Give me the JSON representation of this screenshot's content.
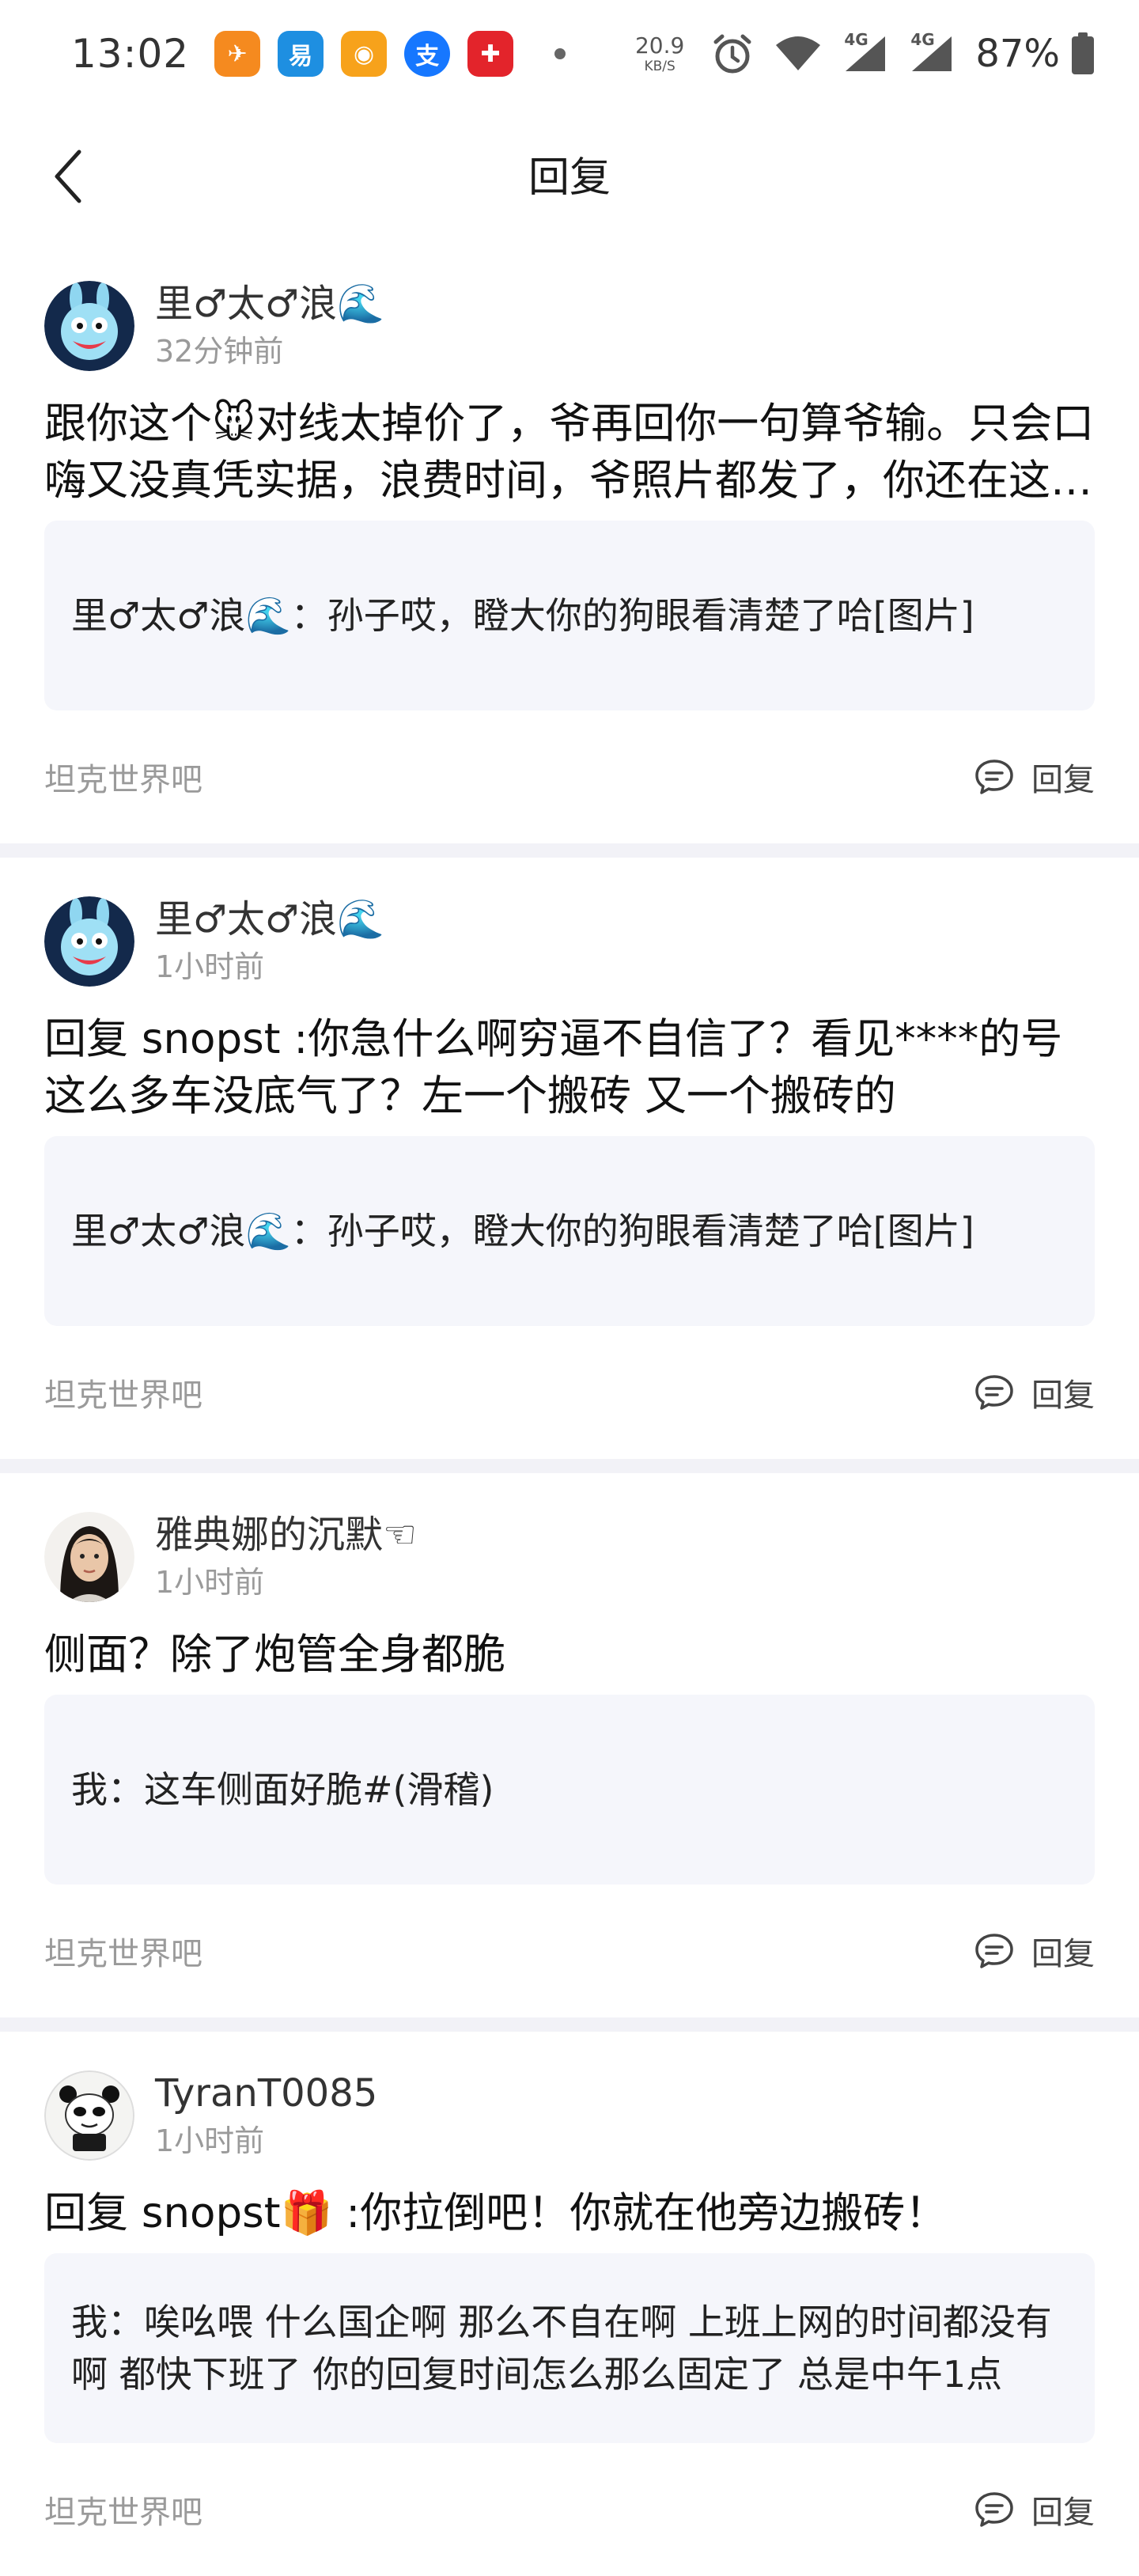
{
  "status_bar": {
    "time": "13:02",
    "net_speed_value": "20.9",
    "net_speed_unit": "KB/S",
    "battery": "87%",
    "app_icons": [
      {
        "name": "meituan-app-icon",
        "glyph": "✈",
        "color": "#f58a1f"
      },
      {
        "name": "yi-app-icon",
        "glyph": "易",
        "color": "#1e8fe1"
      },
      {
        "name": "suning-app-icon",
        "glyph": "◉",
        "color": "#f7a21b"
      },
      {
        "name": "alipay-app-icon",
        "glyph": "支",
        "color": "#1677ff"
      },
      {
        "name": "carrefour-app-icon",
        "glyph": "✚",
        "color": "#e3242b"
      }
    ],
    "network_label_1": "4G",
    "network_label_2": "4G"
  },
  "header": {
    "title": "回复"
  },
  "cards": [
    {
      "author": "里♂太♂浪🌊",
      "time": "32分钟前",
      "reply": "跟你这个🐭对线太掉价了，爷再回你一句算爷输。只会口嗨又没真凭实据，浪费时间，爷照片都发了，你还在这里嘴硬",
      "quote": "里♂太♂浪🌊：孙子哎，瞪大你的狗眼看清楚了哈[图片]",
      "forum": "坦克世界吧",
      "reply_label": "回复",
      "avatar": "cartoon-blue"
    },
    {
      "author": "里♂太♂浪🌊",
      "time": "1小时前",
      "reply": "回复 snopst  :你急什么啊穷逼不自信了？看见****的号这么多车没底气了？左一个搬砖 又一个搬砖的",
      "quote": "里♂太♂浪🌊：孙子哎，瞪大你的狗眼看清楚了哈[图片]",
      "forum": "坦克世界吧",
      "reply_label": "回复",
      "avatar": "cartoon-blue"
    },
    {
      "author": "雅典娜的沉默☜",
      "time": "1小时前",
      "reply": "侧面？除了炮管全身都脆",
      "quote": "我：这车侧面好脆#(滑稽)",
      "forum": "坦克世界吧",
      "reply_label": "回复",
      "avatar": "photo-woman"
    },
    {
      "author": "TyranT0085",
      "time": "1小时前",
      "reply": "回复  snopst🎁 :你拉倒吧！你就在他旁边搬砖！",
      "quote": "我：唉吆喂 什么国企啊 那么不自在啊 上班上网的时间都没有啊 都快下班了 你的回复时间怎么那么固定了 总是中午1点",
      "forum": "坦克世界吧",
      "reply_label": "回复",
      "avatar": "panda"
    }
  ]
}
